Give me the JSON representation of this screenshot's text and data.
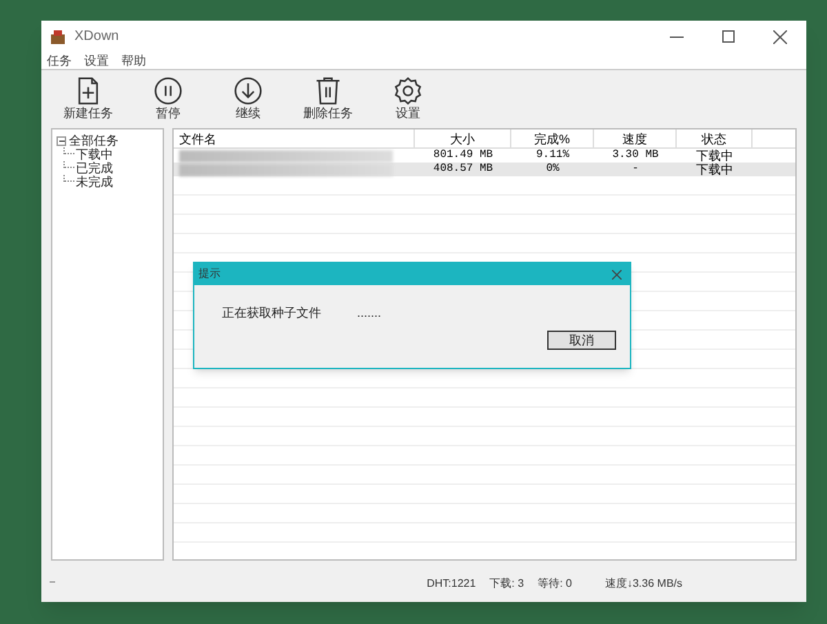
{
  "window": {
    "title": "XDown"
  },
  "menu": [
    "任务",
    "设置",
    "帮助"
  ],
  "toolbar": [
    {
      "kind": "new",
      "label": "新建任务"
    },
    {
      "kind": "pause",
      "label": "暂停"
    },
    {
      "kind": "resume",
      "label": "继续"
    },
    {
      "kind": "delete",
      "label": "删除任务"
    },
    {
      "kind": "settings",
      "label": "设置"
    }
  ],
  "tree": {
    "label": "全部任务",
    "expanded": true,
    "children": [
      {
        "label": "下载中"
      },
      {
        "label": "已完成"
      },
      {
        "label": "未完成"
      }
    ]
  },
  "table": {
    "columns": [
      "文件名",
      "大小",
      "完成%",
      "速度",
      "状态"
    ],
    "rows": [
      {
        "selected": false,
        "size": "801.49 MB",
        "done": "9.11%",
        "speed": "3.30 MB",
        "status": "下载中"
      },
      {
        "selected": true,
        "size": "408.57 MB",
        "done": "0%",
        "speed": "-",
        "status": "下载中"
      }
    ]
  },
  "dialog": {
    "title": "提示",
    "message": "正在获取种子文件",
    "dots": ".......",
    "button": "取消"
  },
  "status_bar": {
    "dht": "DHT:1221",
    "downloading": "下载: 3",
    "waiting": "等待: 0",
    "speed": "速度↓3.36 MB/s"
  }
}
